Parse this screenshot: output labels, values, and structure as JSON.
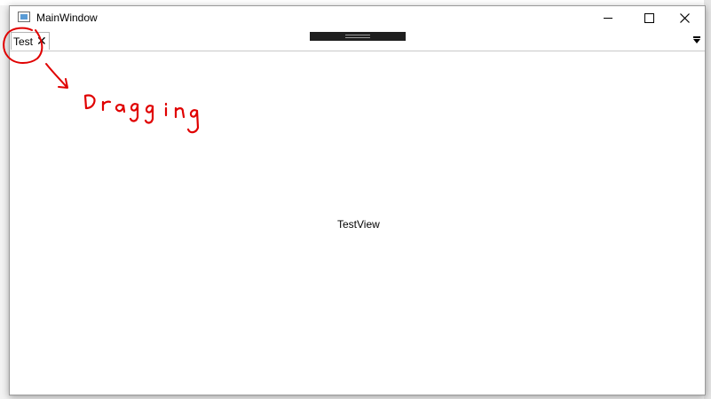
{
  "window": {
    "title": "MainWindow",
    "icons": {
      "app": "window-app-icon",
      "minimize": "minimize-icon",
      "maximize": "maximize-icon",
      "close": "close-icon"
    }
  },
  "tabs": [
    {
      "label": "Test",
      "close_icon": "close-tab-icon"
    }
  ],
  "tabstrip": {
    "drag_handle": "drag-handle",
    "overflow_icon": "tab-overflow-dropdown-icon"
  },
  "content": {
    "text": "TestView"
  },
  "annotation": {
    "color": "#e00000",
    "handwritten_text": "Dragging"
  },
  "colors": {
    "window_border": "#9a9a9a",
    "handle": "#1f1f1f"
  }
}
